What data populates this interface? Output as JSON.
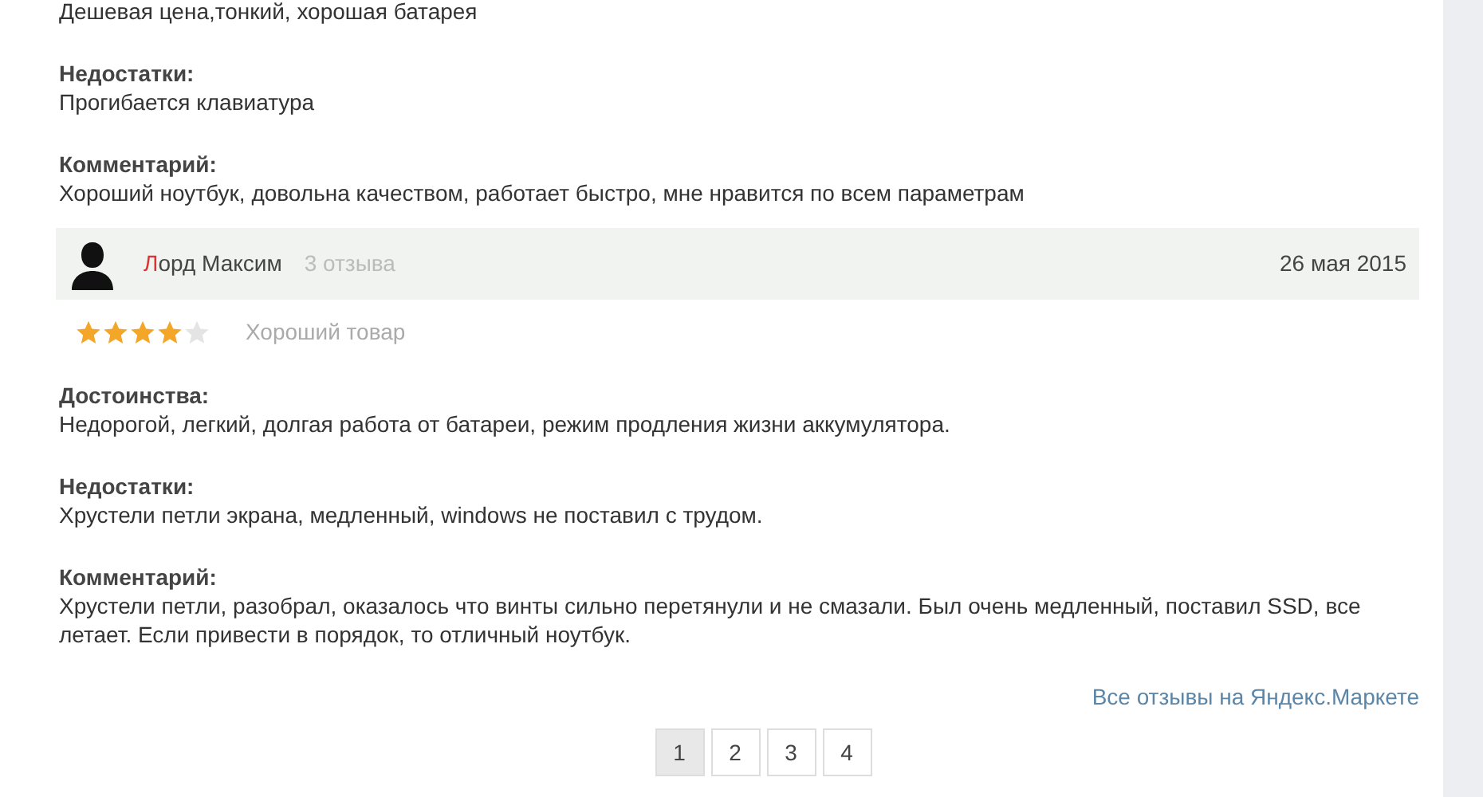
{
  "reviews": [
    {
      "sections": [
        {
          "text": "Дешевая цена,тонкий, хорошая батарея"
        },
        {
          "heading": "Недостатки:",
          "text": "Прогибается клавиатура"
        },
        {
          "heading": "Комментарий:",
          "text": "Хороший ноутбук, довольна качеством, работает быстро, мне нравится по всем параметрам"
        }
      ]
    },
    {
      "author": {
        "name_initial": "Л",
        "name_rest": "орд Максим"
      },
      "review_count": "3 отзыва",
      "date": "26 мая 2015",
      "stars": 4,
      "verdict": "Хороший товар",
      "sections": [
        {
          "heading": "Достоинства:",
          "text": "Недорогой, легкий, долгая работа от батареи, режим продления жизни аккумулятора."
        },
        {
          "heading": "Недостатки:",
          "text": "Хрустели петли экрана, медленный, windows не поставил с трудом."
        },
        {
          "heading": "Комментарий:",
          "text": "Хрустели петли, разобрал, оказалось что винты сильно перетянули и не смазали. Был очень медленный, поставил SSD, все летает. Если привести в порядок, то отличный ноутбук."
        }
      ]
    }
  ],
  "all_reviews_link": "Все отзывы на Яндекс.Маркете",
  "pagination": [
    {
      "label": "1",
      "selected": true
    },
    {
      "label": "2",
      "selected": false
    },
    {
      "label": "3",
      "selected": false
    },
    {
      "label": "4",
      "selected": false
    }
  ]
}
